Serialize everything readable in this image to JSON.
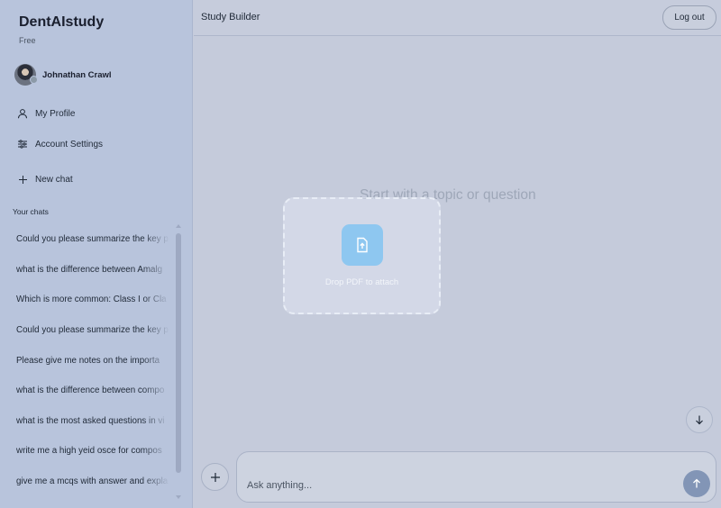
{
  "app": {
    "name": "DentAIstudy",
    "plan": "Free"
  },
  "user": {
    "name": "Johnathan Crawl"
  },
  "nav": {
    "profile": "My Profile",
    "settings": "Account Settings",
    "new_chat": "New chat"
  },
  "chats": {
    "title": "Your chats",
    "items": [
      "Could you please summarize the key p",
      "what is the difference between Amalg",
      "Which is more common: Class I or Cla",
      "Could you please summarize the key p",
      "Please give me notes on the importa",
      "what is the difference between compo",
      "what is the most asked questions in vi",
      "write me a high yeid osce for compos",
      "give me a mcqs with answer and expla"
    ]
  },
  "header": {
    "title": "Study Builder",
    "logout": "Log out"
  },
  "main": {
    "empty_hint": "Start with a topic or question"
  },
  "dropzone": {
    "label": "Drop PDF to attach"
  },
  "composer": {
    "placeholder": "Ask anything..."
  },
  "icons": {
    "profile": "user-icon",
    "settings": "sliders-icon",
    "new_chat": "plus-icon",
    "upload": "file-upload-icon",
    "scroll_bottom": "arrow-down-icon",
    "attach": "plus-icon",
    "send": "arrow-up-icon"
  },
  "colors": {
    "accent": "#8ec7f0",
    "send": "#8295b6"
  }
}
